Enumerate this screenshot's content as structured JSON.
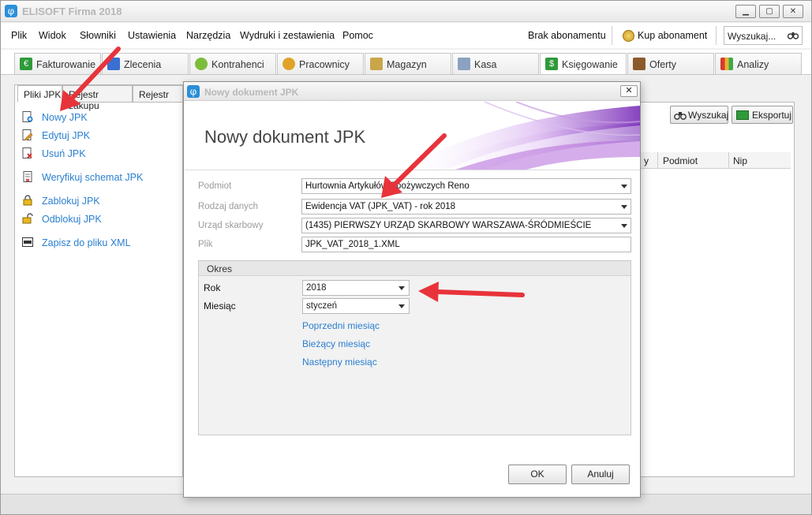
{
  "window": {
    "title": "ELISOFT Firma 2018",
    "min": "▁",
    "max": "▢",
    "close": "✕"
  },
  "menu": [
    "Plik",
    "Widok",
    "Słowniki",
    "Ustawienia",
    "Narzędzia",
    "Wydruki i zestawienia",
    "Pomoc"
  ],
  "subscription": {
    "status": "Brak abonamentu",
    "buy": "Kup abonament"
  },
  "search": {
    "placeholder": "Wyszukaj..."
  },
  "tabs": [
    {
      "label": "Fakturowanie",
      "color": "#2f9a3a"
    },
    {
      "label": "Zlecenia",
      "color": "#3b6fd2"
    },
    {
      "label": "Kontrahenci",
      "color": "#7bbd3a"
    },
    {
      "label": "Pracownicy",
      "color": "#e0a32a"
    },
    {
      "label": "Magazyn",
      "color": "#c9a64a"
    },
    {
      "label": "Kasa",
      "color": "#8aa2c0"
    },
    {
      "label": "Księgowanie",
      "color": "#2f9a3a"
    },
    {
      "label": "Oferty",
      "color": "#8a5a2b"
    },
    {
      "label": "Analizy",
      "color": "#d63b2f"
    }
  ],
  "subtabs": [
    "Pliki JPK",
    "Rejestr zakupu",
    "Rejestr spra"
  ],
  "actions": {
    "new": "Nowy JPK",
    "edit": "Edytuj JPK",
    "delete": "Usuń JPK",
    "verify": "Weryfikuj schemat JPK",
    "lock": "Zablokuj JPK",
    "unlock": "Odblokuj JPK",
    "save_xml": "Zapisz do pliku XML"
  },
  "right": {
    "search": "Wyszukaj",
    "export": "Eksportuj",
    "col1": "y",
    "col2": "Podmiot",
    "col3": "Nip"
  },
  "dialog": {
    "title": "Nowy dokument JPK",
    "heading": "Nowy dokument JPK",
    "fields": {
      "podmiot_label": "Podmiot",
      "podmiot": "Hurtownia Artykułów Spożywczych Reno",
      "rodzaj_label": "Rodzaj danych",
      "rodzaj": "Ewidencja VAT (JPK_VAT) - rok 2018",
      "urzad_label": "Urząd skarbowy",
      "urzad": "(1435) PIERWSZY URZĄD SKARBOWY WARSZAWA-ŚRÓDMIEŚCIE",
      "plik_label": "Plik",
      "plik": "JPK_VAT_2018_1.XML"
    },
    "okres": {
      "title": "Okres",
      "rok_label": "Rok",
      "rok": "2018",
      "miesiac_label": "Miesiąc",
      "miesiac": "styczeń",
      "prev": "Poprzedni miesiąc",
      "current": "Bieżący miesiąc",
      "next": "Następny miesiąc"
    },
    "ok": "OK",
    "cancel": "Anuluj"
  },
  "annotation_color": "#e8333a"
}
